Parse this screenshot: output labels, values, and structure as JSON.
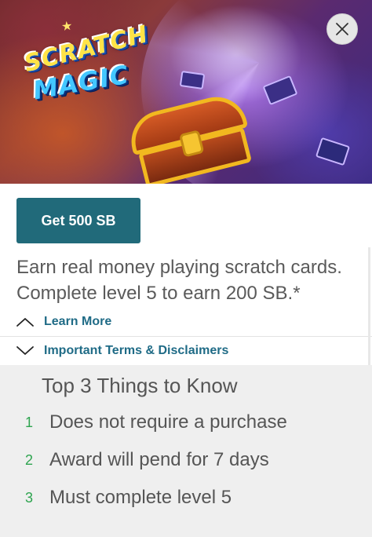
{
  "hero": {
    "logo_line1": "SCRATCH",
    "logo_line2": "MAGIC",
    "close_icon": "close-icon"
  },
  "offer": {
    "cta_label": "Get 500 SB",
    "description_line1": "Earn real money playing scratch cards.",
    "description_line2": "Complete level 5 to earn 200 SB.*"
  },
  "toggles": {
    "learn_more": {
      "label": "Learn More",
      "icon": "chevron-up-icon"
    },
    "terms": {
      "label": "Important Terms & Disclaimers",
      "icon": "chevron-down-icon"
    }
  },
  "things_to_know": {
    "title": "Top 3 Things to Know",
    "items": [
      {
        "number": "1",
        "text": "Does not require a purchase"
      },
      {
        "number": "2",
        "text": "Award will pend for 7 days"
      },
      {
        "number": "3",
        "text": "Must complete level 5"
      }
    ]
  },
  "colors": {
    "cta_background": "#216a7a",
    "link": "#1f6b86",
    "number_accent": "#2ea44f",
    "panel_background": "#efefef"
  }
}
